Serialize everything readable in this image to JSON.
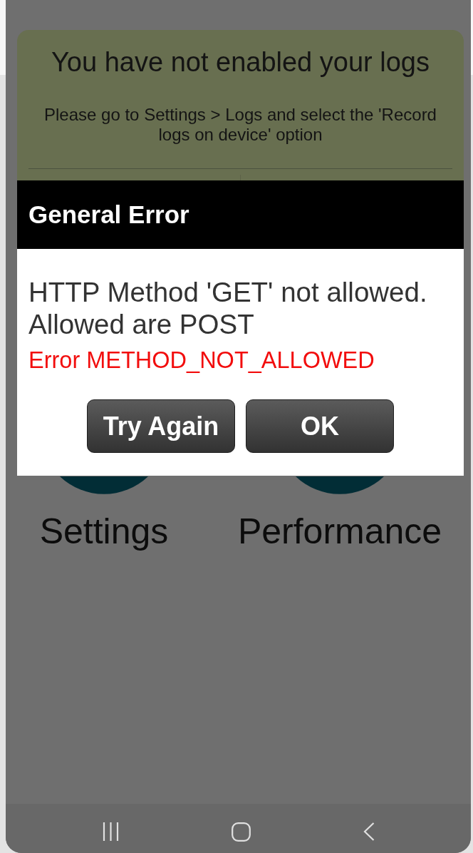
{
  "notice": {
    "title": "You have not enabled your logs",
    "message": "Please go to Settings > Logs and select the 'Record logs on device' option"
  },
  "dialog": {
    "title": "General Error",
    "message": "HTTP Method 'GET' not allowed. Allowed are POST",
    "error": "Error METHOD_NOT_ALLOWED",
    "buttons": [
      {
        "label": "Try Again"
      },
      {
        "label": "OK"
      }
    ]
  },
  "tiles": [
    {
      "label": "Settings"
    },
    {
      "label": "Performance"
    }
  ],
  "nav_bar": {
    "buttons": [
      {
        "kind": "recent"
      },
      {
        "kind": "home"
      },
      {
        "kind": "back"
      }
    ]
  }
}
